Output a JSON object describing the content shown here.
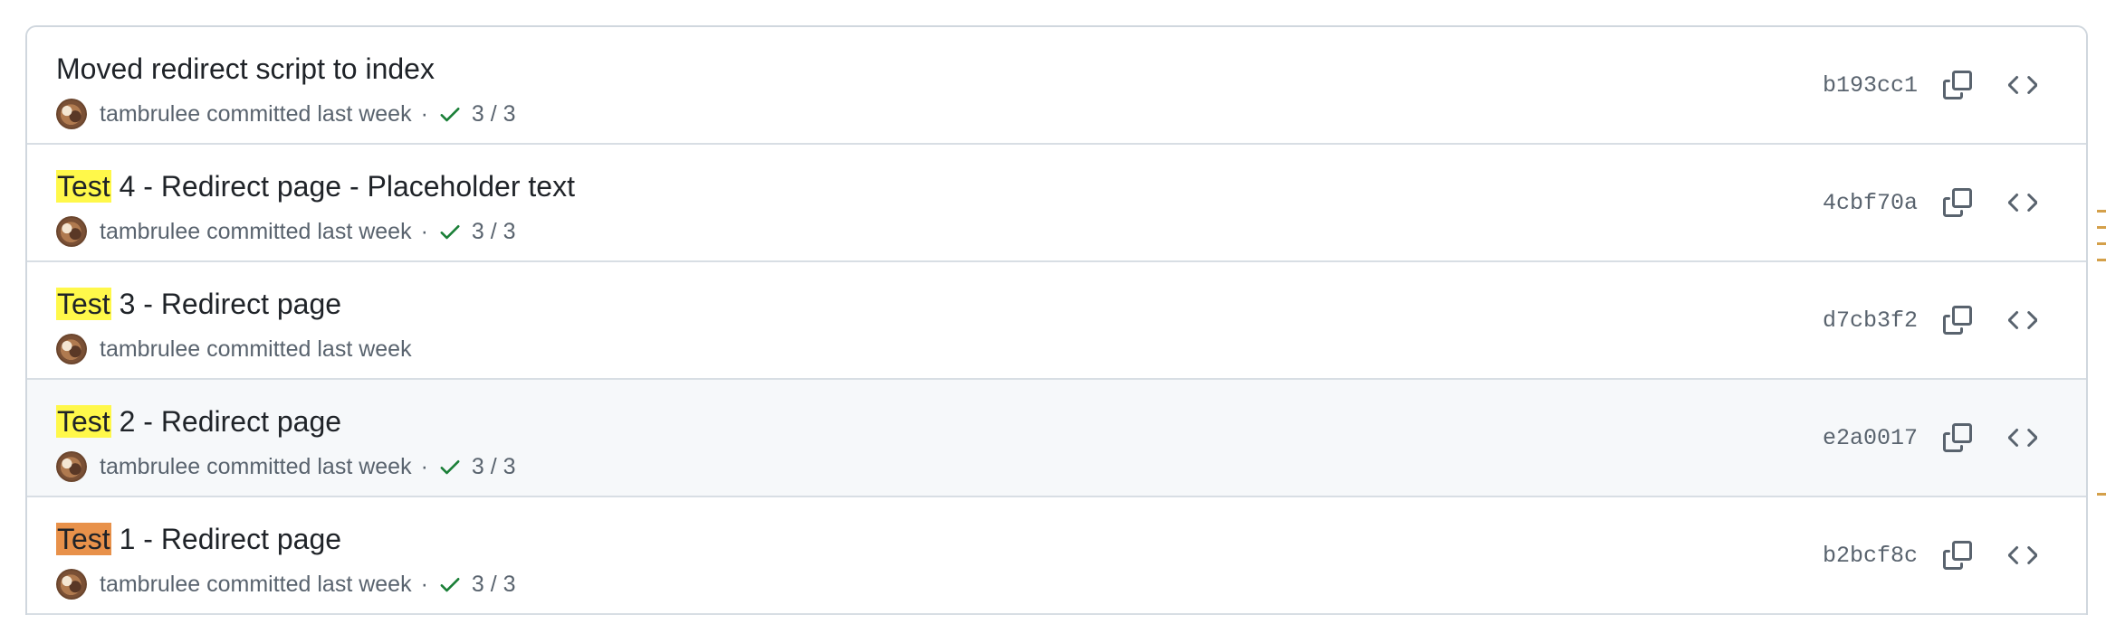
{
  "commits": [
    {
      "title_highlight": "",
      "title_rest": "Moved redirect script to index",
      "author": "tambrulee",
      "meta_text": "committed last week",
      "separator": "·",
      "checks": "3 / 3",
      "has_checks": true,
      "sha": "b193cc1"
    },
    {
      "title_highlight": "Test",
      "title_rest": " 4 - Redirect page - Placeholder text",
      "author": "tambrulee",
      "meta_text": "committed last week",
      "separator": "·",
      "checks": "3 / 3",
      "has_checks": true,
      "sha": "4cbf70a"
    },
    {
      "title_highlight": "Test",
      "title_rest": " 3 - Redirect page",
      "author": "tambrulee",
      "meta_text": "committed last week",
      "separator": "",
      "checks": "",
      "has_checks": false,
      "sha": "d7cb3f2"
    },
    {
      "title_highlight": "Test",
      "title_rest": " 2 - Redirect page",
      "author": "tambrulee",
      "meta_text": "committed last week",
      "separator": "·",
      "checks": "3 / 3",
      "has_checks": true,
      "sha": "e2a0017",
      "hovered": true
    },
    {
      "title_highlight": "Test",
      "title_rest": " 1 - Redirect page",
      "author": "tambrulee",
      "meta_text": "committed last week",
      "separator": "·",
      "checks": "3 / 3",
      "has_checks": true,
      "sha": "b2bcf8c",
      "active_match": true
    }
  ],
  "icons": {
    "check": "check-icon",
    "copy": "copy-icon",
    "browse": "code-icon",
    "avatar": "avatar"
  },
  "colors": {
    "highlight": "#fff84a",
    "active_highlight": "#e8914a",
    "success": "#1a7f37",
    "border": "#d0d7de",
    "muted": "#59636e"
  }
}
